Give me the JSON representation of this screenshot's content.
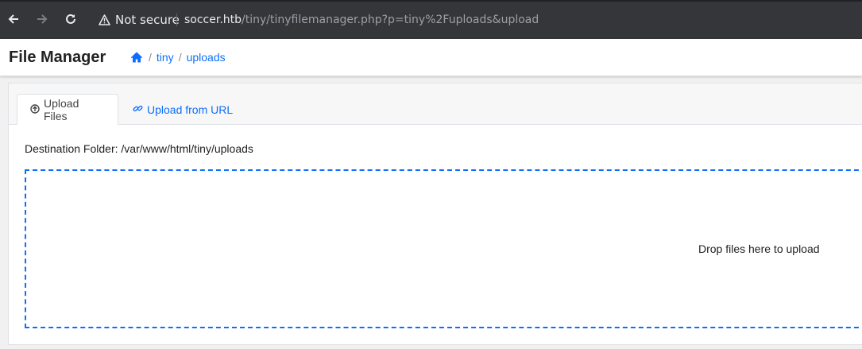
{
  "browser": {
    "security_label": "Not secure",
    "url_host": "soccer.htb",
    "url_path": "/tiny/tinyfilemanager.php?p=tiny%2Fuploads&upload"
  },
  "header": {
    "title": "File Manager",
    "breadcrumb": [
      "tiny",
      "uploads"
    ],
    "breadcrumb_sep": "/"
  },
  "tabs": [
    {
      "label": "Upload Files",
      "icon": "upload-circle-icon",
      "active": true
    },
    {
      "label": "Upload from URL",
      "icon": "link-icon",
      "active": false
    }
  ],
  "destination": "Destination Folder: /var/www/html/tiny/uploads",
  "dropzone": {
    "message": "Drop files here to upload"
  },
  "colors": {
    "accent": "#0d6efd",
    "browser_bg": "#35363a"
  }
}
